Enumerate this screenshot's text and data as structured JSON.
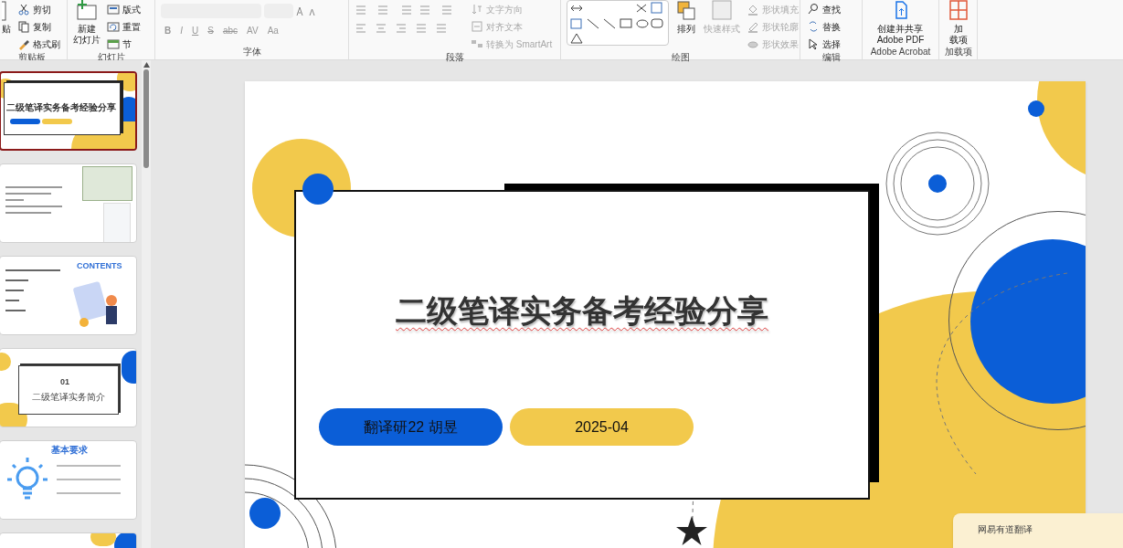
{
  "ribbon": {
    "groups": [
      {
        "kind": "clipboard",
        "label": "剪贴板",
        "big": {
          "lines": [
            "贴"
          ]
        },
        "items": [
          {
            "label": "剪切",
            "disabled": false
          },
          {
            "label": "复制",
            "disabled": false
          },
          {
            "label": "格式刷",
            "disabled": false
          }
        ]
      },
      {
        "kind": "slides",
        "label": "幻灯片",
        "big": {
          "lines": [
            "新建",
            "幻灯片"
          ]
        },
        "items": [
          {
            "label": "版式",
            "disabled": false
          },
          {
            "label": "重置",
            "disabled": false
          },
          {
            "label": "节",
            "disabled": false
          }
        ]
      },
      {
        "kind": "font",
        "label": "字体",
        "buttons": [
          "B",
          "I",
          "U",
          "S",
          "abc",
          "AV",
          "Aa"
        ]
      },
      {
        "kind": "paragraph",
        "label": "段落",
        "items": [
          {
            "label": "文字方向",
            "disabled": true
          },
          {
            "label": "对齐文本",
            "disabled": true
          },
          {
            "label": "转换为 SmartArt",
            "disabled": true
          }
        ]
      },
      {
        "kind": "drawing",
        "label": "绘图",
        "big": {
          "lines": [
            "排列"
          ]
        },
        "big2": {
          "lines": [
            "快速样式"
          ],
          "disabled": true
        },
        "items": [
          {
            "label": "形状填充",
            "disabled": true
          },
          {
            "label": "形状轮廓",
            "disabled": true
          },
          {
            "label": "形状效果",
            "disabled": true
          }
        ]
      },
      {
        "kind": "editing",
        "label": "编辑",
        "items": [
          {
            "label": "查找",
            "disabled": false
          },
          {
            "label": "替换",
            "disabled": false
          },
          {
            "label": "选择",
            "disabled": false
          }
        ]
      },
      {
        "kind": "acrobat",
        "label": "Adobe Acrobat",
        "big": {
          "lines": [
            "创建并共享",
            "Adobe PDF"
          ]
        }
      },
      {
        "kind": "addins",
        "label": "加载项",
        "big": {
          "lines": [
            "加",
            "载项"
          ]
        }
      }
    ]
  },
  "thumbnails": [
    {
      "kind": "title",
      "selected": true,
      "title": "二级笔译实务备考经验分享"
    },
    {
      "kind": "text",
      "selected": false
    },
    {
      "kind": "contents",
      "selected": false,
      "title": "CONTENTS"
    },
    {
      "kind": "section",
      "selected": false,
      "number": "01",
      "title": "二级笔译实务简介"
    },
    {
      "kind": "requirements",
      "selected": false,
      "title": "基本要求"
    },
    {
      "kind": "partial",
      "selected": false
    }
  ],
  "slide": {
    "title": "二级笔译实务备考经验分享",
    "author": "翻译研22 胡昱",
    "date": "2025-04"
  },
  "popup": {
    "title": "网易有道翻译"
  }
}
